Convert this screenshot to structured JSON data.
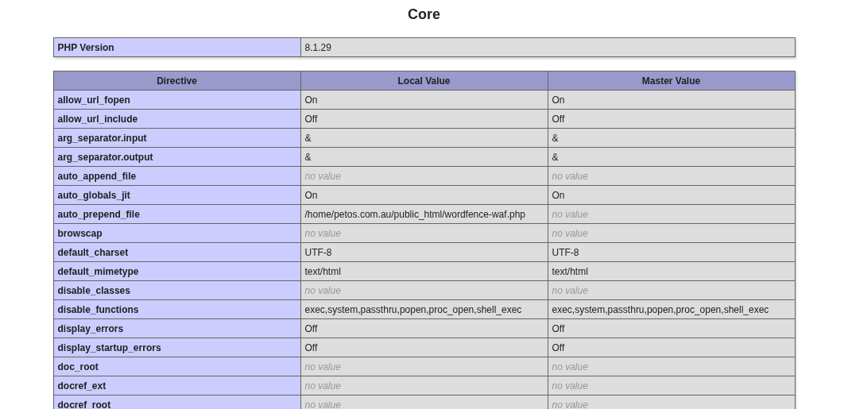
{
  "title": "Core",
  "version_row": {
    "label": "PHP Version",
    "value": "8.1.29"
  },
  "table": {
    "columns": [
      "Directive",
      "Local Value",
      "Master Value"
    ],
    "rows": [
      {
        "directive": "allow_url_fopen",
        "local": {
          "text": "On",
          "kind": "value"
        },
        "master": {
          "text": "On",
          "kind": "value"
        }
      },
      {
        "directive": "allow_url_include",
        "local": {
          "text": "Off",
          "kind": "value"
        },
        "master": {
          "text": "Off",
          "kind": "value"
        }
      },
      {
        "directive": "arg_separator.input",
        "local": {
          "text": "&",
          "kind": "value"
        },
        "master": {
          "text": "&",
          "kind": "value"
        }
      },
      {
        "directive": "arg_separator.output",
        "local": {
          "text": "&",
          "kind": "value"
        },
        "master": {
          "text": "&",
          "kind": "value"
        }
      },
      {
        "directive": "auto_append_file",
        "local": {
          "text": "no value",
          "kind": "empty"
        },
        "master": {
          "text": "no value",
          "kind": "empty"
        }
      },
      {
        "directive": "auto_globals_jit",
        "local": {
          "text": "On",
          "kind": "value"
        },
        "master": {
          "text": "On",
          "kind": "value"
        }
      },
      {
        "directive": "auto_prepend_file",
        "local": {
          "text": "/home/petos.com.au/public_html/wordfence-waf.php",
          "kind": "value"
        },
        "master": {
          "text": "no value",
          "kind": "empty"
        }
      },
      {
        "directive": "browscap",
        "local": {
          "text": "no value",
          "kind": "empty"
        },
        "master": {
          "text": "no value",
          "kind": "empty"
        }
      },
      {
        "directive": "default_charset",
        "local": {
          "text": "UTF-8",
          "kind": "value"
        },
        "master": {
          "text": "UTF-8",
          "kind": "value"
        }
      },
      {
        "directive": "default_mimetype",
        "local": {
          "text": "text/html",
          "kind": "value"
        },
        "master": {
          "text": "text/html",
          "kind": "value"
        }
      },
      {
        "directive": "disable_classes",
        "local": {
          "text": "no value",
          "kind": "empty"
        },
        "master": {
          "text": "no value",
          "kind": "empty"
        }
      },
      {
        "directive": "disable_functions",
        "local": {
          "text": "exec,system,passthru,popen,proc_open,shell_exec",
          "kind": "value"
        },
        "master": {
          "text": "exec,system,passthru,popen,proc_open,shell_exec",
          "kind": "value"
        }
      },
      {
        "directive": "display_errors",
        "local": {
          "text": "Off",
          "kind": "value"
        },
        "master": {
          "text": "Off",
          "kind": "value"
        }
      },
      {
        "directive": "display_startup_errors",
        "local": {
          "text": "Off",
          "kind": "value"
        },
        "master": {
          "text": "Off",
          "kind": "value"
        }
      },
      {
        "directive": "doc_root",
        "local": {
          "text": "no value",
          "kind": "empty"
        },
        "master": {
          "text": "no value",
          "kind": "empty"
        }
      },
      {
        "directive": "docref_ext",
        "local": {
          "text": "no value",
          "kind": "empty"
        },
        "master": {
          "text": "no value",
          "kind": "empty"
        }
      },
      {
        "directive": "docref_root",
        "local": {
          "text": "no value",
          "kind": "empty"
        },
        "master": {
          "text": "no value",
          "kind": "empty"
        }
      }
    ]
  }
}
